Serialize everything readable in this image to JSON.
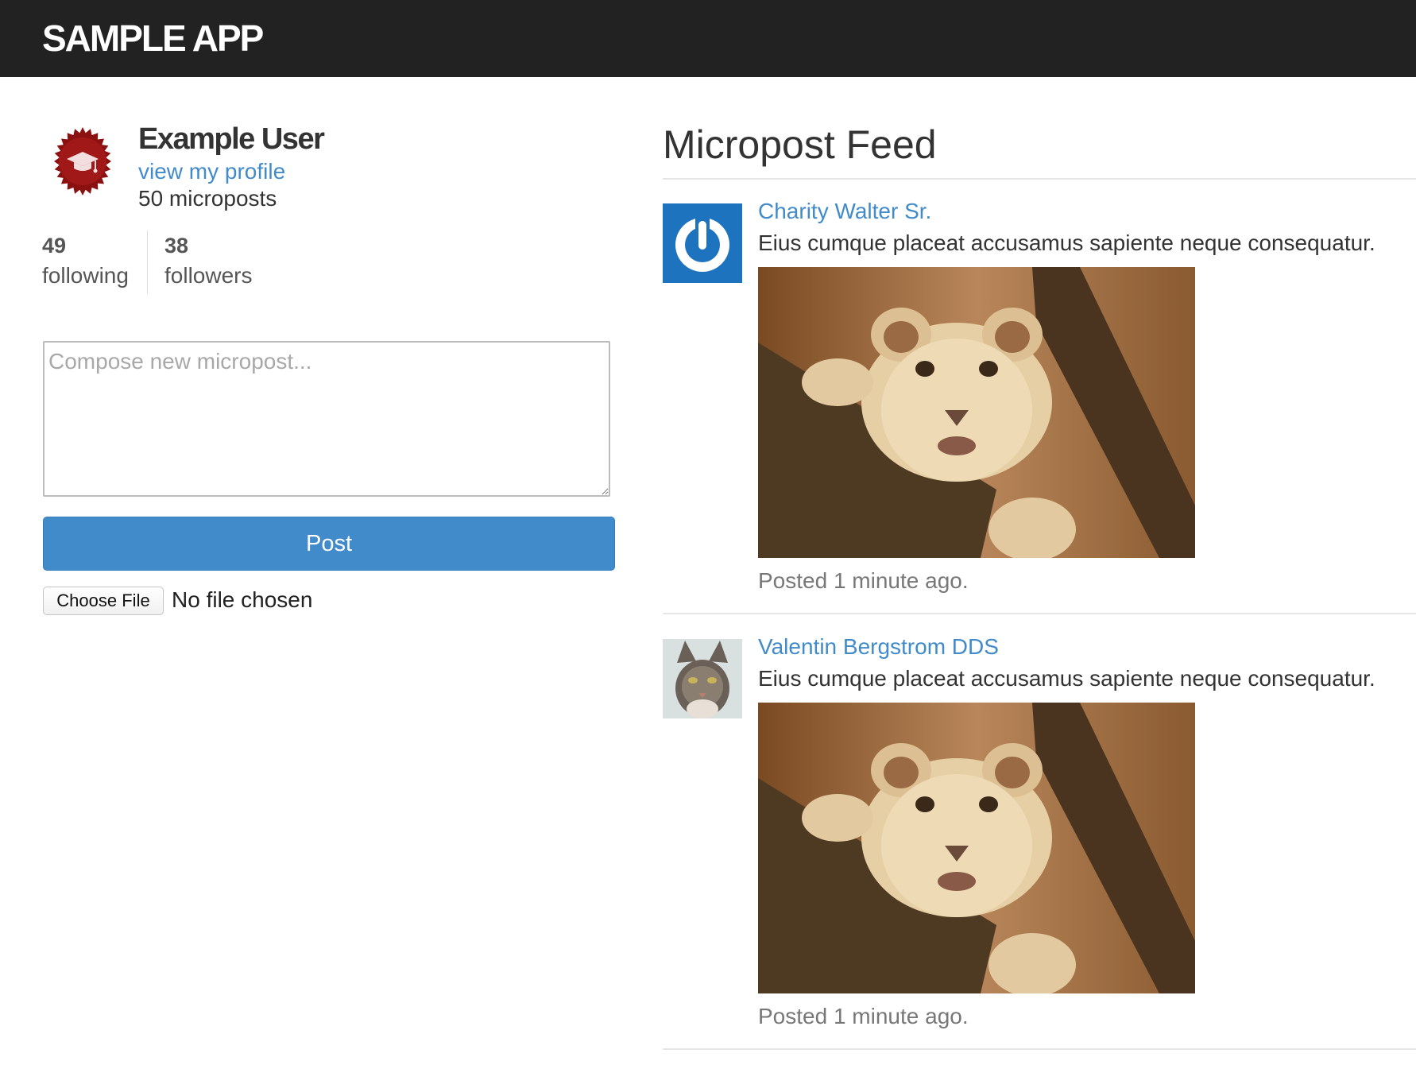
{
  "header": {
    "logo": "SAMPLE APP"
  },
  "user_info": {
    "name": "Example User",
    "profile_link": "view my profile",
    "micropost_count": "50 microposts"
  },
  "stats": {
    "following_count": "49",
    "following_label": "following",
    "followers_count": "38",
    "followers_label": "followers"
  },
  "micropost_form": {
    "placeholder": "Compose new micropost...",
    "submit_label": "Post",
    "file_button_label": "Choose File",
    "file_status": "No file chosen"
  },
  "feed": {
    "title": "Micropost Feed",
    "items": [
      {
        "user": "Charity Walter Sr.",
        "content": "Eius cumque placeat accusamus sapiente neque consequatur.",
        "timestamp": "Posted 1 minute ago.",
        "avatar_icon": "power-icon",
        "image": "lion-cub-photo"
      },
      {
        "user": "Valentin Bergstrom DDS",
        "content": "Eius cumque placeat accusamus sapiente neque consequatur.",
        "timestamp": "Posted 1 minute ago.",
        "avatar_icon": "cat-photo",
        "image": "lion-cub-photo"
      }
    ]
  },
  "colors": {
    "header_bg": "#222222",
    "link": "#428bca",
    "button": "#428bca",
    "gravatar_badge": "#8b1111",
    "gravatar_blue": "#1e73be"
  }
}
